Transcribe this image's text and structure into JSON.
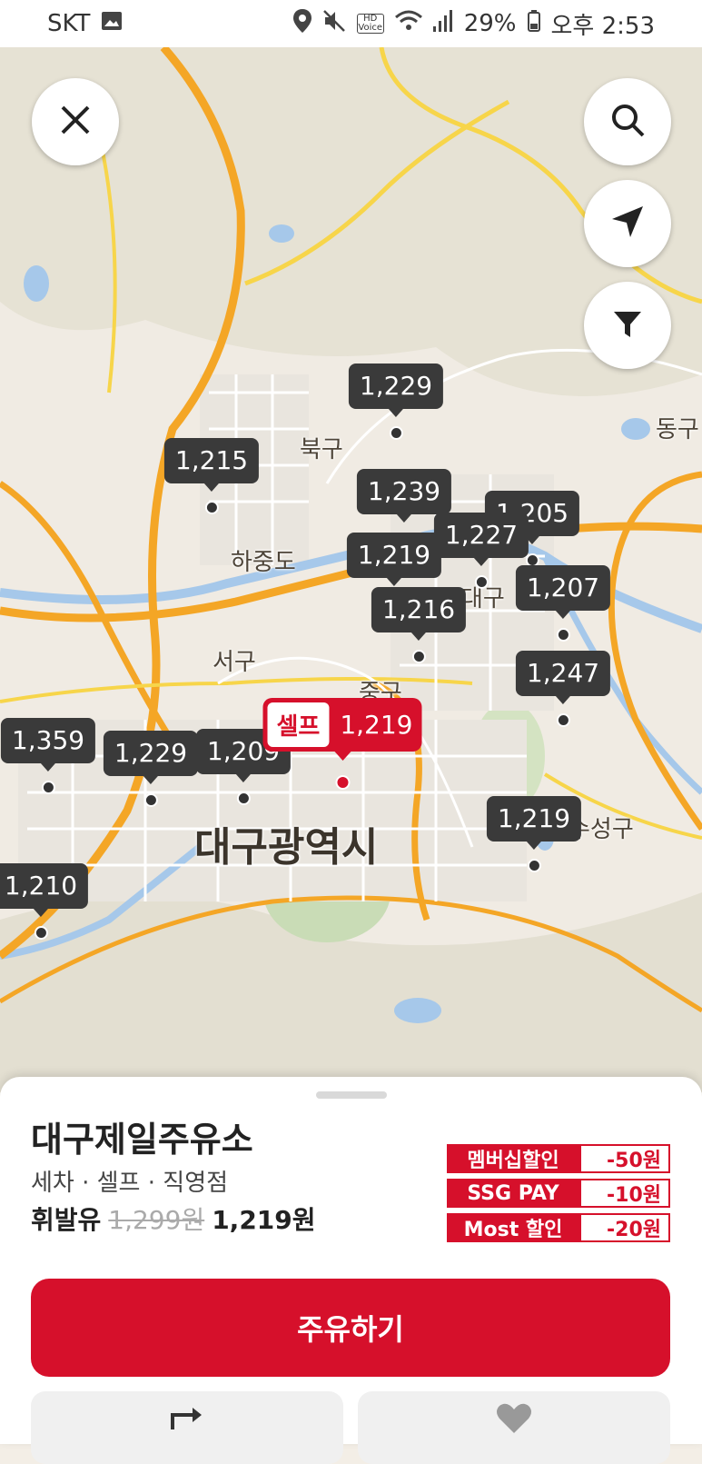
{
  "status": {
    "carrier": "SKT",
    "hd_voice": "HD Voice",
    "battery": "29%",
    "time": "오후 2:53"
  },
  "map": {
    "labels": [
      "북구",
      "하중도",
      "서구",
      "중구",
      "대구광역시",
      "수성구",
      "동구",
      "대구"
    ],
    "markers": [
      "1,229",
      "1,215",
      "1,239",
      "1,205",
      "1,227",
      "1,219",
      "1,207",
      "1,216",
      "1,247",
      "1,359",
      "1,229",
      "1,209",
      "1,219",
      "1,210"
    ],
    "selected": {
      "tag": "셀프",
      "price": "1,219"
    }
  },
  "station": {
    "name": "대구제일주유소",
    "tags": "세차 · 셀프 · 직영점",
    "fuel_label": "휘발유",
    "old_price": "1,299원",
    "new_price": "1,219원",
    "discounts": [
      {
        "name": "멤버십할인",
        "amount": "-50원"
      },
      {
        "name": "SSG PAY",
        "amount": "-10원"
      },
      {
        "name": "Most 할인",
        "amount": "-20원"
      }
    ],
    "primary_button": "주유하기"
  },
  "colors": {
    "accent": "#d6102b",
    "marker": "#3a3a3a"
  }
}
